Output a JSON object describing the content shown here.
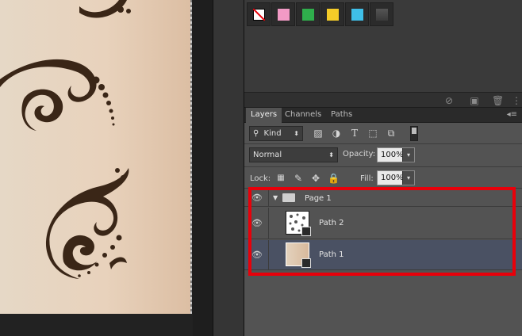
{
  "swatches": {
    "items": [
      {
        "name": "none-swatch",
        "color": "#ffffff"
      },
      {
        "name": "pink-swatch",
        "color": "#f29ac5"
      },
      {
        "name": "green-swatch",
        "color": "#2fae4c"
      },
      {
        "name": "yellow-swatch",
        "color": "#f5cc28"
      },
      {
        "name": "cyan-swatch",
        "color": "#3fbfe8"
      },
      {
        "name": "dark-swatch",
        "color": "#4a4a4a"
      }
    ]
  },
  "layers_panel": {
    "tabs": [
      {
        "label": "Layers"
      },
      {
        "label": "Channels"
      },
      {
        "label": "Paths"
      }
    ],
    "filter_kind": "Kind",
    "blend_mode": "Normal",
    "opacity_label": "Opacity:",
    "opacity_value": "100%",
    "lock_label": "Lock:",
    "fill_label": "Fill:",
    "fill_value": "100%",
    "layers": [
      {
        "name": "Page 1",
        "type": "group",
        "visible": true
      },
      {
        "name": "Path 2",
        "type": "layer",
        "visible": true
      },
      {
        "name": "Path 1",
        "type": "layer",
        "visible": true,
        "selected": true
      }
    ]
  },
  "colors": {
    "highlight": "#e8000a",
    "selected_row": "#4a5163"
  }
}
